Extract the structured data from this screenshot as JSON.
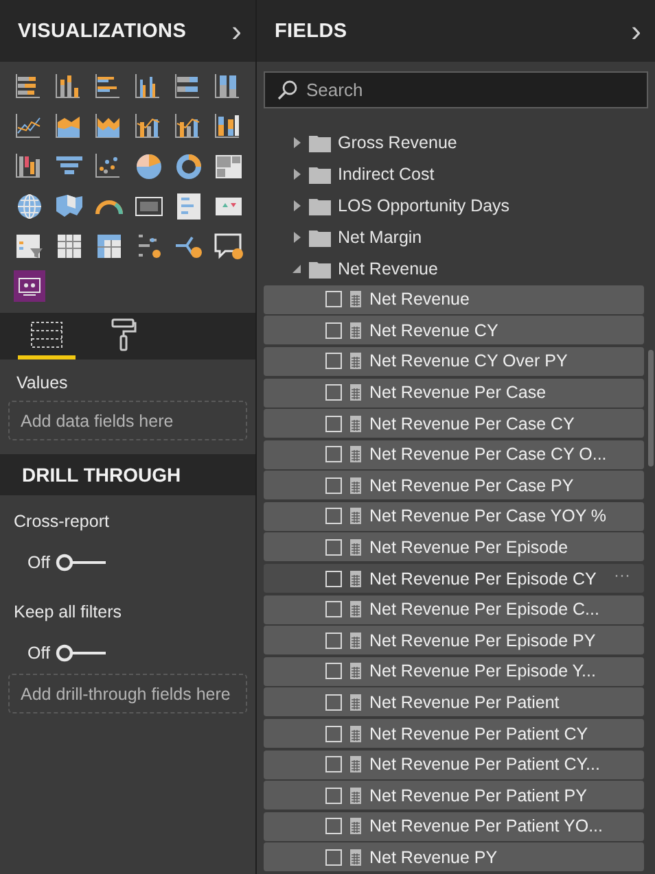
{
  "visualizations_panel": {
    "title": "VISUALIZATIONS",
    "expand_arrow": "›"
  },
  "pane_tabs": [
    {
      "kind": "fields",
      "selected": true
    },
    {
      "kind": "format",
      "selected": false
    }
  ],
  "values_section": {
    "label": "Values",
    "placeholder": "Add data fields here"
  },
  "drill_through": {
    "title": "DRILL THROUGH",
    "toggles": [
      {
        "label": "Cross-report",
        "value": "Off",
        "on": false
      },
      {
        "label": "Keep all filters",
        "value": "Off",
        "on": false
      }
    ],
    "placeholder": "Add drill-through fields here"
  },
  "fields_panel": {
    "title": "FIELDS",
    "expand_arrow": "›",
    "search": {
      "placeholder": "Search"
    },
    "tree": [
      {
        "label": "Gross Revenue",
        "expanded": false
      },
      {
        "label": "Indirect Cost",
        "expanded": false
      },
      {
        "label": "LOS Opportunity Days",
        "expanded": false
      },
      {
        "label": "Net Margin",
        "expanded": false
      },
      {
        "label": "Net Revenue",
        "expanded": true,
        "children": [
          {
            "label": "Net Revenue",
            "checked": false,
            "hovered": false
          },
          {
            "label": "Net Revenue CY",
            "checked": false,
            "hovered": false
          },
          {
            "label": "Net Revenue CY Over PY",
            "checked": false,
            "hovered": false
          },
          {
            "label": "Net Revenue Per Case",
            "checked": false,
            "hovered": false
          },
          {
            "label": "Net Revenue Per Case CY",
            "checked": false,
            "hovered": false
          },
          {
            "label": "Net Revenue Per Case CY O...",
            "checked": false,
            "hovered": false
          },
          {
            "label": "Net Revenue Per Case PY",
            "checked": false,
            "hovered": false
          },
          {
            "label": "Net Revenue Per Case YOY %",
            "checked": false,
            "hovered": false
          },
          {
            "label": "Net Revenue Per Episode",
            "checked": false,
            "hovered": false
          },
          {
            "label": "Net Revenue Per Episode CY",
            "checked": false,
            "hovered": true,
            "more": "···"
          },
          {
            "label": "Net Revenue Per Episode C...",
            "checked": false,
            "hovered": false
          },
          {
            "label": "Net Revenue Per Episode PY",
            "checked": false,
            "hovered": false
          },
          {
            "label": "Net Revenue Per Episode Y...",
            "checked": false,
            "hovered": false
          },
          {
            "label": "Net Revenue Per Patient",
            "checked": false,
            "hovered": false
          },
          {
            "label": "Net Revenue Per Patient CY",
            "checked": false,
            "hovered": false
          },
          {
            "label": "Net Revenue Per Patient CY...",
            "checked": false,
            "hovered": false
          },
          {
            "label": "Net Revenue Per Patient PY",
            "checked": false,
            "hovered": false
          },
          {
            "label": "Net Revenue Per Patient YO...",
            "checked": false,
            "hovered": false
          },
          {
            "label": "Net Revenue PY",
            "checked": false,
            "hovered": false
          }
        ]
      }
    ]
  }
}
